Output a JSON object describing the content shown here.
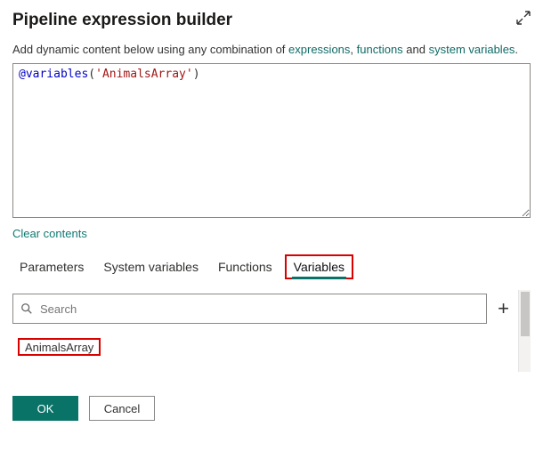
{
  "header": {
    "title": "Pipeline expression builder"
  },
  "helpText": {
    "prefix": "Add dynamic content below using any combination of ",
    "link_expressions": "expressions",
    "sep1": ", ",
    "link_functions": "functions",
    "sep2": " and ",
    "link_sysvars": "system variables",
    "suffix": "."
  },
  "editor": {
    "at": "@",
    "func": "variables",
    "open": "(",
    "q1": "'",
    "arg": "AnimalsArray",
    "q2": "'",
    "close": ")"
  },
  "actions": {
    "clear": "Clear contents"
  },
  "tabs": {
    "parameters": "Parameters",
    "system_variables": "System variables",
    "functions": "Functions",
    "variables": "Variables"
  },
  "search": {
    "placeholder": "Search",
    "add": "+"
  },
  "variables_list": {
    "item0": "AnimalsArray"
  },
  "footer": {
    "ok": "OK",
    "cancel": "Cancel"
  }
}
